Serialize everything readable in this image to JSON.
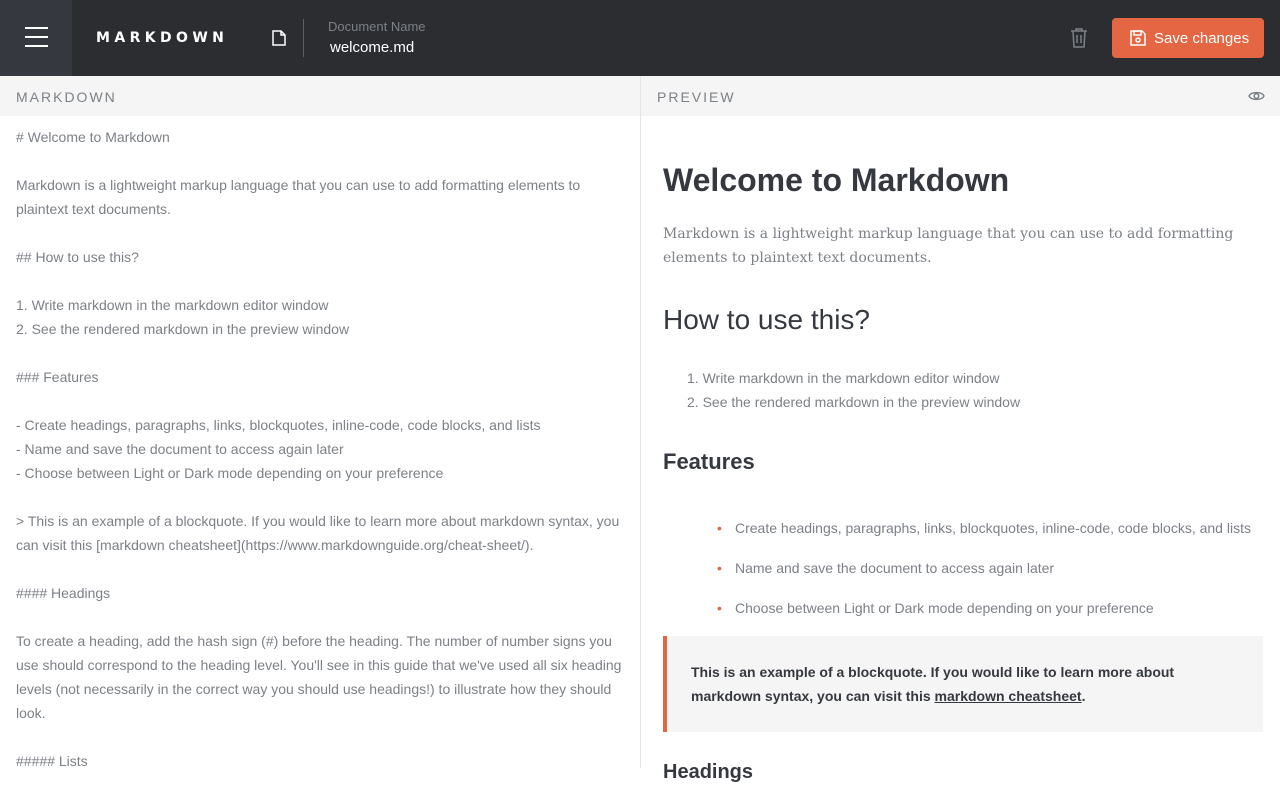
{
  "app": {
    "brand": "MARKDOWN"
  },
  "document": {
    "label": "Document Name",
    "name": "welcome.md"
  },
  "actions": {
    "save_label": "Save changes"
  },
  "panes": {
    "editor_title": "MARKDOWN",
    "preview_title": "PREVIEW"
  },
  "editor": {
    "lines": [
      "# Welcome to Markdown",
      "",
      "Markdown is a lightweight markup language that you can use to add formatting elements to plaintext text documents.",
      "",
      "## How to use this?",
      "",
      "1. Write markdown in the markdown editor window",
      "2. See the rendered markdown in the preview window",
      "",
      "### Features",
      "",
      "- Create headings, paragraphs, links, blockquotes, inline-code, code blocks, and lists",
      "- Name and save the document to access again later",
      "- Choose between Light or Dark mode depending on your preference",
      "",
      "> This is an example of a blockquote. If you would like to learn more about markdown syntax, you can visit this [markdown cheatsheet](https://www.markdownguide.org/cheat-sheet/).",
      "",
      "#### Headings",
      "",
      "To create a heading, add the hash sign (#) before the heading. The number of number signs you use should correspond to the heading level. You'll see in this guide that we've used all six heading levels (not necessarily in the correct way you should use headings!) to illustrate how they should look.",
      "",
      "##### Lists"
    ]
  },
  "preview": {
    "h1": "Welcome to Markdown",
    "intro": "Markdown is a lightweight markup language that you can use to add formatting elements to plaintext text documents.",
    "h2": "How to use this?",
    "ordered": [
      "1. Write markdown in the markdown editor window",
      "2. See the rendered markdown in the preview window"
    ],
    "h3": "Features",
    "features": [
      "Create headings, paragraphs, links, blockquotes, inline-code, code blocks, and lists",
      "Name and save the document to access again later",
      "Choose between Light or Dark mode depending on your preference"
    ],
    "quote_text": "This is an example of a blockquote. If you would like to learn more about markdown syntax, you can visit this ",
    "quote_link": "markdown cheatsheet",
    "quote_end": ".",
    "h4": "Headings"
  },
  "colors": {
    "accent": "#e46643",
    "topbar": "#2b2d31",
    "menu": "#35393f"
  },
  "icons": {
    "menu": "hamburger-icon",
    "document": "document-icon",
    "delete": "trash-icon",
    "save": "floppy-icon",
    "preview": "eye-icon"
  }
}
